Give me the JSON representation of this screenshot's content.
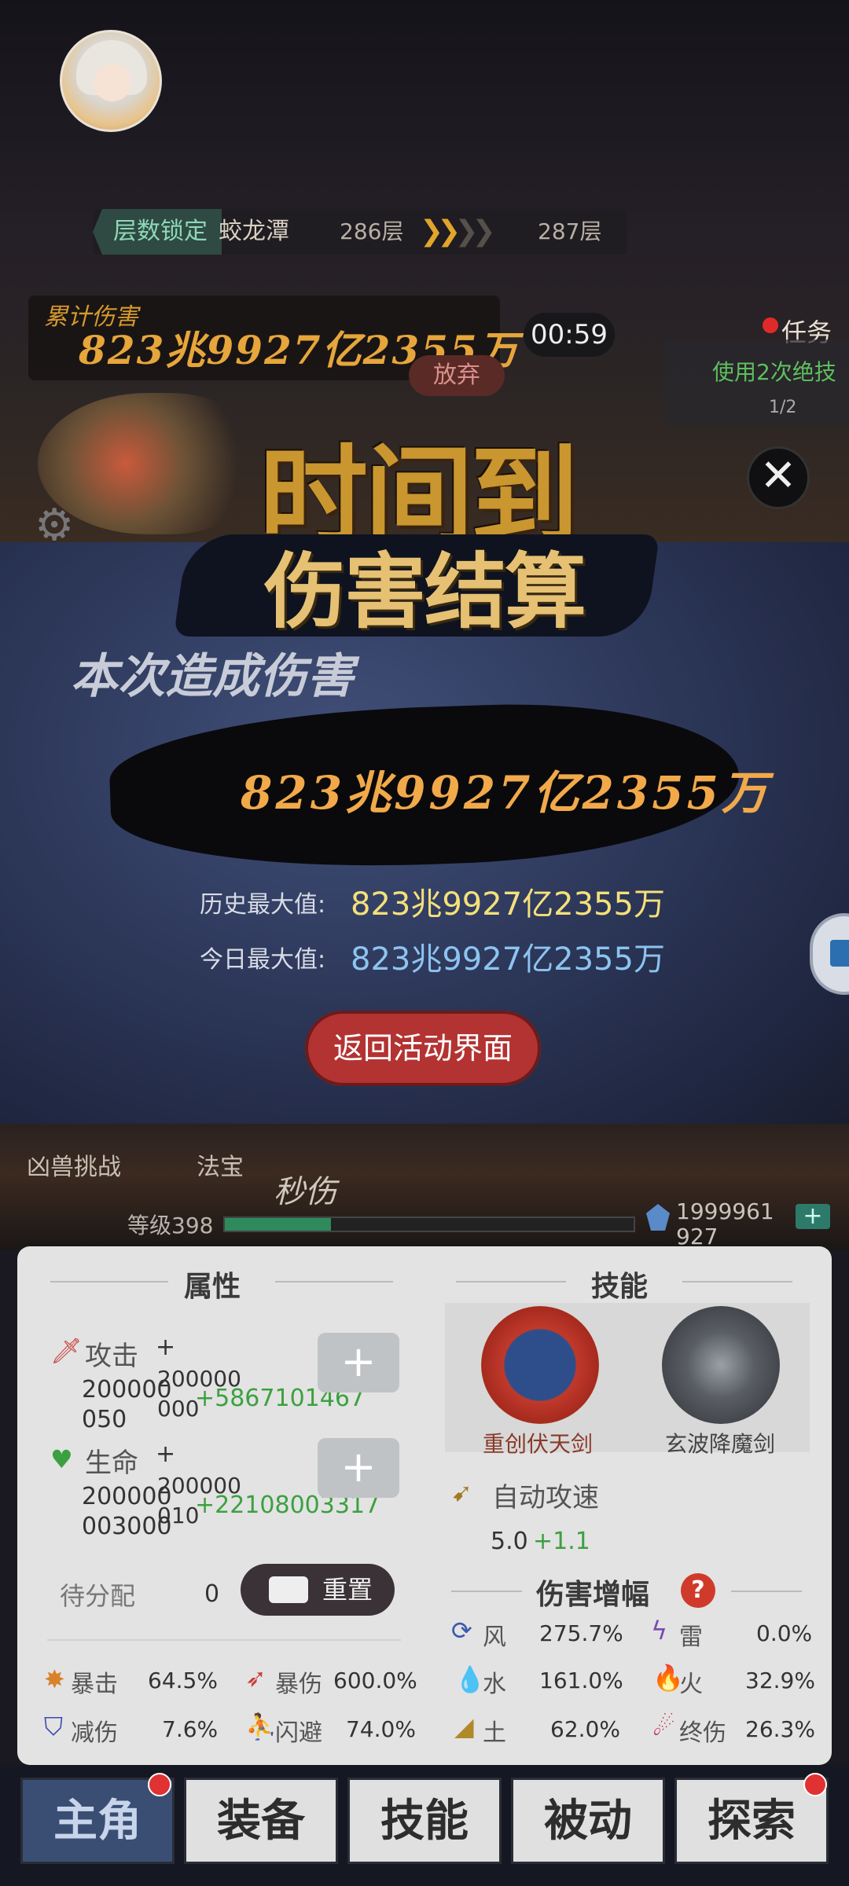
{
  "header": {
    "floor_lock": "层数锁定",
    "floor_name": "蛟龙潭",
    "current_floor": "286层",
    "next_floor": "287层",
    "cumulative_label": "累计伤害",
    "cumulative_value": "823兆9927亿2355万",
    "timer": "00:59",
    "give_up": "放弃",
    "task_label": "任务",
    "task_text": "使用2次绝技",
    "task_progress": "1/2",
    "time_up": "时间到"
  },
  "modal": {
    "title": "伤害结算",
    "caused_label": "本次造成伤害",
    "damage_value": "823兆9927亿2355万",
    "history_label": "历史最大值:",
    "history_value": "823兆9927亿2355万",
    "today_label": "今日最大值:",
    "today_value": "823兆9927亿2355万",
    "return_button": "返回活动界面"
  },
  "midbar": {
    "beast_challenge": "凶兽挑战",
    "fabao": "法宝",
    "seckill": "秒伤",
    "level": "等级398",
    "exp_fraction": 0.26,
    "gold": "1999961927",
    "gold_plus": "+"
  },
  "attributes": {
    "title": "属性",
    "attack_label": "攻击",
    "attack_base": "200000050",
    "attack_plus_label": "+",
    "attack_extra": "200000000",
    "attack_bonus": "+5867101467",
    "hp_label": "生命",
    "hp_base": "200000003000",
    "hp_plus_label": "+",
    "hp_extra": "200000010",
    "hp_bonus": "+22108003317",
    "pending_label": "待分配",
    "pending_value": "0",
    "reset_label": "重置",
    "crit_label": "暴击",
    "crit_value": "64.5%",
    "crit_dmg_label": "暴伤",
    "crit_dmg_value": "600.0%",
    "reduce_label": "减伤",
    "reduce_value": "7.6%",
    "dodge_label": "闪避",
    "dodge_value": "74.0%"
  },
  "skills": {
    "title": "技能",
    "skill1": "重创伏天剑",
    "skill2": "玄波降魔剑",
    "auto_speed_label": "自动攻速",
    "auto_speed_value": "5.0",
    "auto_speed_bonus": "+1.1",
    "amplify_title": "伤害增幅",
    "help": "?",
    "wind_label": "风",
    "wind_value": "275.7%",
    "thunder_label": "雷",
    "thunder_value": "0.0%",
    "water_label": "水",
    "water_value": "161.0%",
    "fire_label": "火",
    "fire_value": "32.9%",
    "earth_label": "土",
    "earth_value": "62.0%",
    "final_label": "终伤",
    "final_value": "26.3%"
  },
  "nav": {
    "tabs": [
      "主角",
      "装备",
      "技能",
      "被动",
      "探索"
    ]
  }
}
